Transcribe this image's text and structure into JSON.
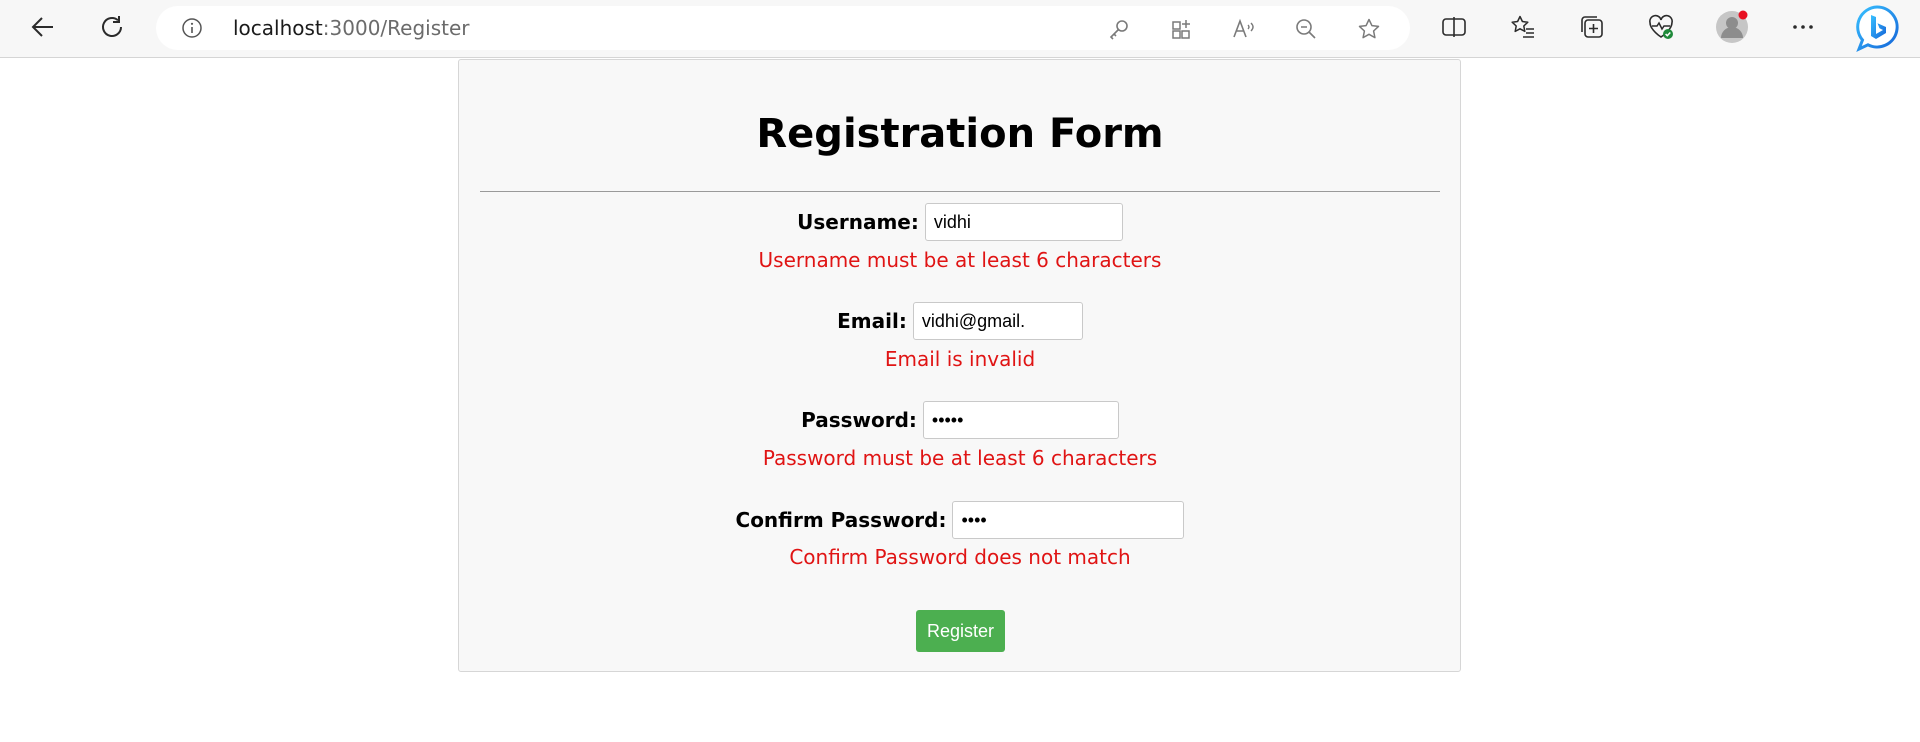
{
  "browser": {
    "url_host": "localhost",
    "url_path": ":3000/Register",
    "icons": {
      "back": "back-arrow-icon",
      "refresh": "refresh-icon",
      "info": "info-icon",
      "key": "key-icon",
      "apps": "apps-icon",
      "read_aloud": "read-aloud-icon",
      "zoom_out": "zoom-out-icon",
      "favorite": "star-icon",
      "split": "split-screen-icon",
      "favorites": "favorites-icon",
      "collections": "collections-icon",
      "health": "browser-essentials-icon",
      "profile": "profile-icon",
      "more": "more-icon",
      "bing": "bing-copilot-icon"
    }
  },
  "form": {
    "title": "Registration Form",
    "username": {
      "label": "Username:",
      "value": "vidhi",
      "error": "Username must be at least 6 characters"
    },
    "email": {
      "label": "Email:",
      "value": "vidhi@gmail.",
      "error": "Email is invalid"
    },
    "password": {
      "label": "Password:",
      "value": "•••••",
      "error": "Password must be at least 6 characters"
    },
    "confirm_password": {
      "label": "Confirm Password:",
      "value": "••••",
      "error": "Confirm Password does not match"
    },
    "submit_label": "Register"
  },
  "colors": {
    "error": "#e01414",
    "button": "#4caf50",
    "card_bg": "#f8f8f8",
    "profile_dot": "#e81123",
    "bing_blue": "#1a73e8"
  }
}
